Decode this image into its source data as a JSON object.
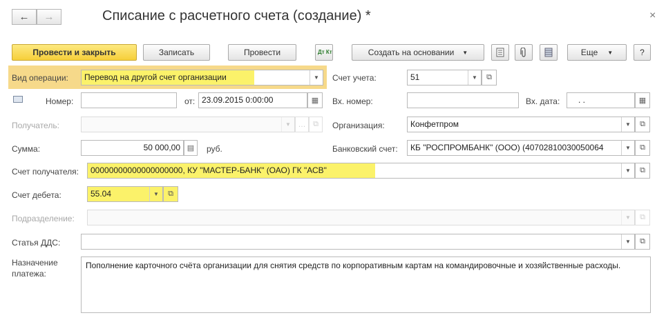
{
  "window": {
    "title": "Списание с расчетного счета (создание) *",
    "back_icon": "←",
    "forward_icon": "→",
    "close_icon": "×"
  },
  "toolbar": {
    "post_close": "Провести и закрыть",
    "save": "Записать",
    "post": "Провести",
    "dtkt": "Дт Кт",
    "create_based": "Создать на основании",
    "more": "Еще",
    "help": "?"
  },
  "form": {
    "operation_type": {
      "label": "Вид операции:",
      "value": "Перевод на другой счет организации"
    },
    "account": {
      "label": "Счет учета:",
      "value": "51"
    },
    "number": {
      "label": "Номер:",
      "value": ""
    },
    "from_label": "от:",
    "date": {
      "value": "23.09.2015  0:00:00"
    },
    "in_number": {
      "label": "Вх. номер:",
      "value": ""
    },
    "in_date": {
      "label": "Вх. дата:",
      "value": ". ."
    },
    "recipient": {
      "label": "Получатель:",
      "value": ""
    },
    "organization": {
      "label": "Организация:",
      "value": "Конфетпром"
    },
    "amount": {
      "label": "Сумма:",
      "value": "50 000,00",
      "currency": "руб."
    },
    "bank_account": {
      "label": "Банковский счет:",
      "value": "КБ \"РОСПРОМБАНК\" (ООО) (40702810030050064"
    },
    "recipient_account": {
      "label": "Счет получателя:",
      "value": "00000000000000000000, КУ \"МАСТЕР-БАНК\" (ОАО) ГК \"АСВ\""
    },
    "debit_account": {
      "label": "Счет дебета:",
      "value": "55.04"
    },
    "department": {
      "label": "Подразделение:",
      "value": ""
    },
    "dds_article": {
      "label": "Статья ДДС:",
      "value": ""
    },
    "purpose": {
      "label_line1": "Назначение",
      "label_line2": "платежа:",
      "value": "Пополнение карточного счёта организации для снятия средств по корпоративным картам на командировочные и хозяйственные расходы."
    }
  }
}
